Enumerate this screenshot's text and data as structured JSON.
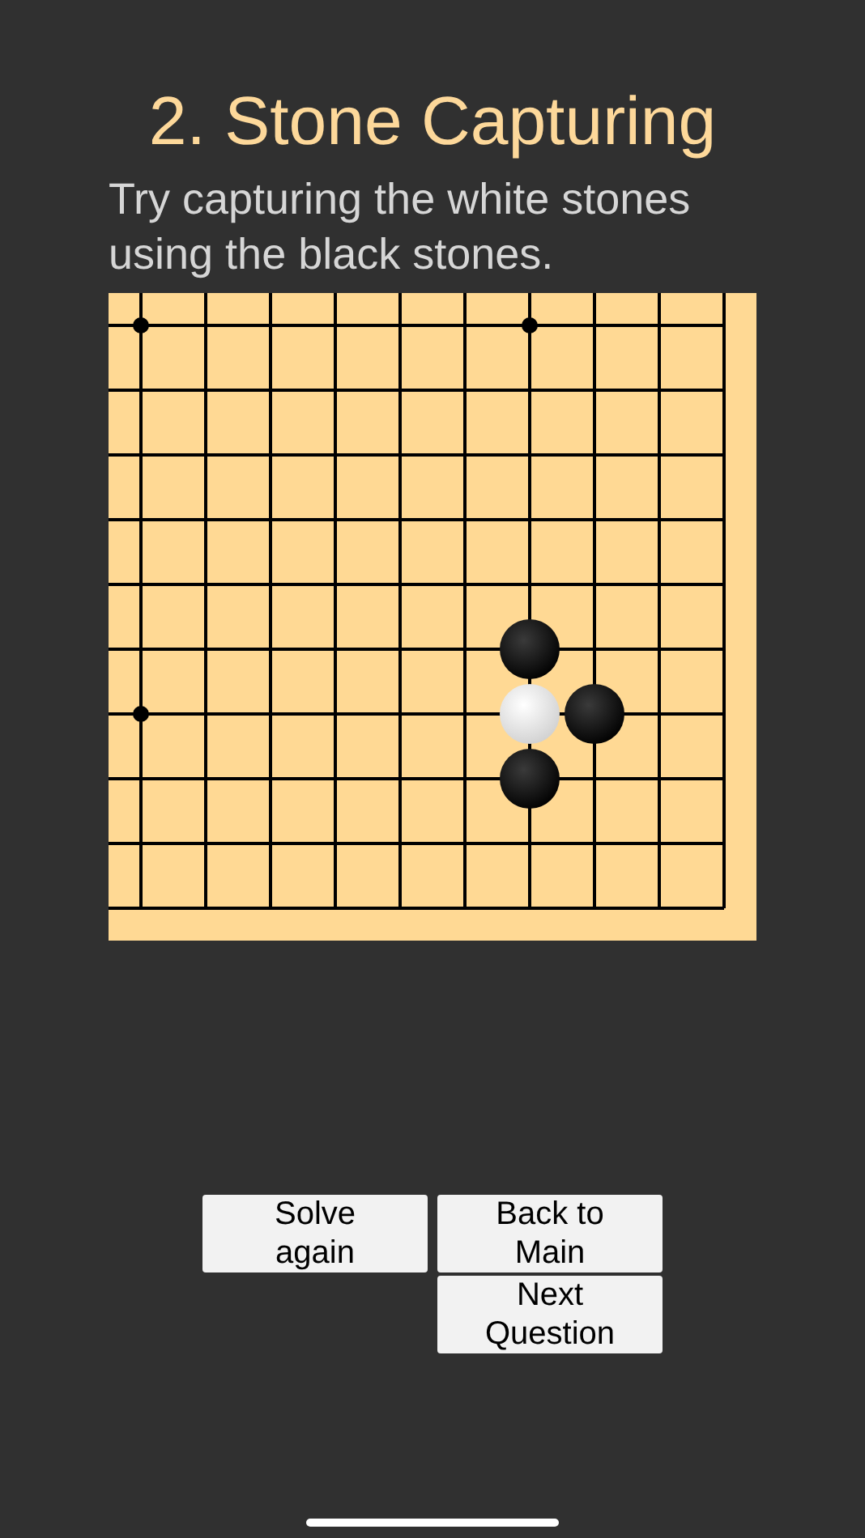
{
  "title": "2. Stone Capturing",
  "instruction": "Try capturing the white stones using the black stones.",
  "board": {
    "rows": [
      [
        {
          "kind": "star"
        },
        {
          "kind": "empty"
        },
        {
          "kind": "empty"
        },
        {
          "kind": "empty"
        },
        {
          "kind": "empty"
        },
        {
          "kind": "empty"
        },
        {
          "kind": "star"
        },
        {
          "kind": "empty"
        },
        {
          "kind": "empty"
        },
        {
          "kind": "empty"
        }
      ],
      [
        {
          "kind": "empty"
        },
        {
          "kind": "empty"
        },
        {
          "kind": "empty"
        },
        {
          "kind": "empty"
        },
        {
          "kind": "empty"
        },
        {
          "kind": "empty"
        },
        {
          "kind": "empty"
        },
        {
          "kind": "empty"
        },
        {
          "kind": "empty"
        },
        {
          "kind": "empty"
        }
      ],
      [
        {
          "kind": "empty"
        },
        {
          "kind": "empty"
        },
        {
          "kind": "empty"
        },
        {
          "kind": "empty"
        },
        {
          "kind": "empty"
        },
        {
          "kind": "empty"
        },
        {
          "kind": "empty"
        },
        {
          "kind": "empty"
        },
        {
          "kind": "empty"
        },
        {
          "kind": "empty"
        }
      ],
      [
        {
          "kind": "empty"
        },
        {
          "kind": "empty"
        },
        {
          "kind": "empty"
        },
        {
          "kind": "empty"
        },
        {
          "kind": "empty"
        },
        {
          "kind": "empty"
        },
        {
          "kind": "empty"
        },
        {
          "kind": "empty"
        },
        {
          "kind": "empty"
        },
        {
          "kind": "empty"
        }
      ],
      [
        {
          "kind": "empty"
        },
        {
          "kind": "empty"
        },
        {
          "kind": "empty"
        },
        {
          "kind": "empty"
        },
        {
          "kind": "empty"
        },
        {
          "kind": "empty"
        },
        {
          "kind": "empty"
        },
        {
          "kind": "empty"
        },
        {
          "kind": "empty"
        },
        {
          "kind": "empty"
        }
      ],
      [
        {
          "kind": "empty"
        },
        {
          "kind": "empty"
        },
        {
          "kind": "empty"
        },
        {
          "kind": "empty"
        },
        {
          "kind": "empty"
        },
        {
          "kind": "empty"
        },
        {
          "kind": "black"
        },
        {
          "kind": "empty"
        },
        {
          "kind": "empty"
        },
        {
          "kind": "empty"
        }
      ],
      [
        {
          "kind": "star"
        },
        {
          "kind": "empty"
        },
        {
          "kind": "empty"
        },
        {
          "kind": "empty"
        },
        {
          "kind": "empty"
        },
        {
          "kind": "empty"
        },
        {
          "kind": "white"
        },
        {
          "kind": "black"
        },
        {
          "kind": "empty"
        },
        {
          "kind": "empty"
        }
      ],
      [
        {
          "kind": "empty"
        },
        {
          "kind": "empty"
        },
        {
          "kind": "empty"
        },
        {
          "kind": "empty"
        },
        {
          "kind": "empty"
        },
        {
          "kind": "empty"
        },
        {
          "kind": "black"
        },
        {
          "kind": "empty"
        },
        {
          "kind": "empty"
        },
        {
          "kind": "empty"
        }
      ],
      [
        {
          "kind": "empty"
        },
        {
          "kind": "empty"
        },
        {
          "kind": "empty"
        },
        {
          "kind": "empty"
        },
        {
          "kind": "empty"
        },
        {
          "kind": "empty"
        },
        {
          "kind": "empty"
        },
        {
          "kind": "empty"
        },
        {
          "kind": "empty"
        },
        {
          "kind": "empty"
        }
      ],
      [
        {
          "kind": "empty"
        },
        {
          "kind": "empty"
        },
        {
          "kind": "empty"
        },
        {
          "kind": "empty"
        },
        {
          "kind": "empty"
        },
        {
          "kind": "empty"
        },
        {
          "kind": "empty"
        },
        {
          "kind": "empty"
        },
        {
          "kind": "empty"
        },
        {
          "kind": "empty"
        }
      ]
    ]
  },
  "buttons": [
    {
      "label": "Solve again"
    },
    {
      "label": "Back to Main"
    },
    {
      "label": "Next Question"
    }
  ]
}
